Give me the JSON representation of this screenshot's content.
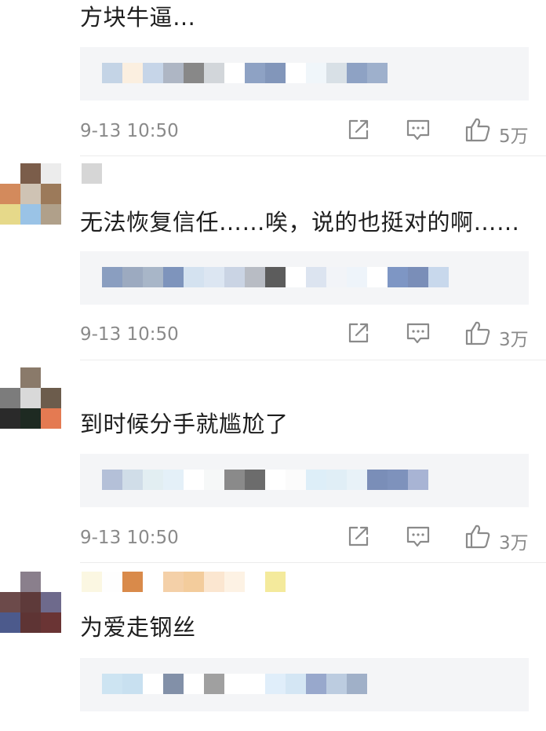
{
  "comments": [
    {
      "text": "方块牛逼…",
      "time": "9-13 10:50",
      "likes": "5万",
      "avatar_colors": [
        "#ffffff",
        "#2c8ea7",
        "#f2f2f2"
      ]
    },
    {
      "text": "无法恢复信任……唉，说的也挺对的啊……",
      "time": "9-13 10:50",
      "likes": "3万",
      "avatar_colors": [
        "#ffffff",
        "#7b5d4a",
        "#ececec",
        "#d38a5c",
        "#cfc3b4",
        "#9c7a5a",
        "#e6d98a",
        "#9ac3e6",
        "#b0a08a"
      ],
      "username_colors": [
        "#d6d6d6"
      ]
    },
    {
      "text": "到时候分手就尴尬了",
      "time": "9-13 10:50",
      "likes": "3万",
      "avatar_colors": [
        "#ffffff",
        "#8a7a6a",
        "#ffffff",
        "#7c7c7c",
        "#d9d9d9",
        "#6c5c4c",
        "#2a2a2a",
        "#1e2a22",
        "#e47a52"
      ]
    },
    {
      "text": "为爱走钢丝",
      "time": "",
      "likes": "",
      "avatar_colors": [
        "#ffffff",
        "#8a7f8c",
        "#ffffff",
        "#6c4a4a",
        "#5e3a3a",
        "#6e6a8c",
        "#4c5a8c",
        "#5e3434",
        "#6a3434"
      ],
      "username_colors": [
        "#fbf7e2",
        "#fefefe",
        "#d98a4a",
        "#ffffff",
        "#f4d0a8",
        "#f3cc9c",
        "#fbe6d0",
        "#fdf2e4",
        "#ffffff",
        "#f4ea9c"
      ]
    }
  ],
  "reply_blur_colors": [
    [
      "#c4d4e6",
      "#fbefe0",
      "#c6d5e8",
      "#aeb6c4",
      "#888888",
      "#d2d6da",
      "#ffffff",
      "#8ea2c4",
      "#8296ba",
      "#ffffff",
      "#f0f6fa",
      "#d8e0e6",
      "#8ea2c4",
      "#9eb0cc"
    ],
    [
      "#8a9ec0",
      "#9caac0",
      "#a8b6c8",
      "#7e94bc",
      "#d4e2f0",
      "#dce6f2",
      "#cad4e4",
      "#b8bcc4",
      "#5c5c5c",
      "#ffffff",
      "#dce4f0",
      "#f2f4f8",
      "#eef4fa",
      "#ffffff",
      "#7e96c4",
      "#7a8eb8",
      "#c8d8ec"
    ],
    [
      "#b4c0d8",
      "#d0dde8",
      "#e2eef2",
      "#e4f0f8",
      "#ffffff",
      "#f6f8f8",
      "#8a8a8a",
      "#6c6c6c",
      "#ffffff",
      "#fbfbfb",
      "#ddeef8",
      "#e0eef6",
      "#e8f2f8",
      "#7a8eb8",
      "#7e92bc",
      "#a8b4d4"
    ],
    [
      "#cde4f2",
      "#c8e0f0",
      "#ffffff",
      "#8290a8",
      "#ffffff",
      "#a0a0a0",
      "#ffffff",
      "#ffffff",
      "#e0eefa",
      "#d4e6f4",
      "#98a8cc",
      "#bccce0",
      "#a0b0c8"
    ]
  ],
  "icons": {
    "share": "share-icon",
    "reply": "comment-icon",
    "like": "thumbs-up-icon"
  },
  "colors": {
    "meta_text": "#8a8a8a",
    "reply_box_bg": "#f4f5f7",
    "text": "#1e1e1e"
  }
}
